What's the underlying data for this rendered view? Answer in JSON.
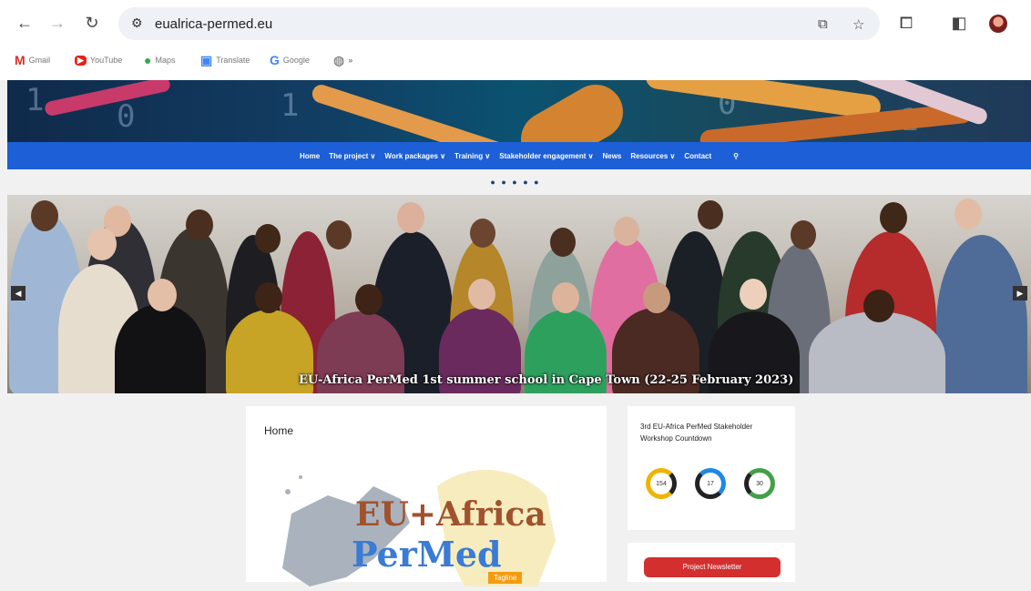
{
  "browser": {
    "url": "eualrica-permed.eu",
    "bookmarks": [
      {
        "label": "Gmail",
        "icon": "gmail-icon"
      },
      {
        "label": "YouTube",
        "icon": "youtube-icon"
      },
      {
        "label": "Maps",
        "icon": "maps-icon"
      },
      {
        "label": "Translate",
        "icon": "translate-icon"
      },
      {
        "label": "Google",
        "icon": "google-icon"
      }
    ]
  },
  "nav": {
    "items": [
      {
        "label": "Home"
      },
      {
        "label": "The project ∨"
      },
      {
        "label": "Work packages ∨"
      },
      {
        "label": "Training ∨"
      },
      {
        "label": "Stakeholder engagement ∨"
      },
      {
        "label": "News"
      },
      {
        "label": "Resources ∨"
      },
      {
        "label": "Contact"
      }
    ],
    "search_icon": "search-icon"
  },
  "carousel": {
    "indicators": "● ● ● ● ●",
    "caption": "EU-Africa PerMed 1st summer school in Cape Town (22-25 February 2023)",
    "prev_label": "◀",
    "next_label": "▶"
  },
  "main": {
    "title": "Home",
    "logo_line1": "EU+Africa",
    "logo_line2": "PerMed",
    "logo_tag": "Tagline"
  },
  "sidebar": {
    "workshop_title": "3rd EU-Africa PerMed Stakeholder Workshop Countdown",
    "countdown": [
      {
        "value": "154",
        "color": "#f0b400"
      },
      {
        "value": "17",
        "color": "#1e88e5"
      },
      {
        "value": "30",
        "color": "#43a047"
      }
    ],
    "newsletter_label": "Project Newsletter"
  },
  "colors": {
    "nav_blue": "#1c5fd6",
    "newsletter_red": "#d32f2f",
    "logo_brown": "#a0522d",
    "logo_blue": "#3a7bd5"
  }
}
